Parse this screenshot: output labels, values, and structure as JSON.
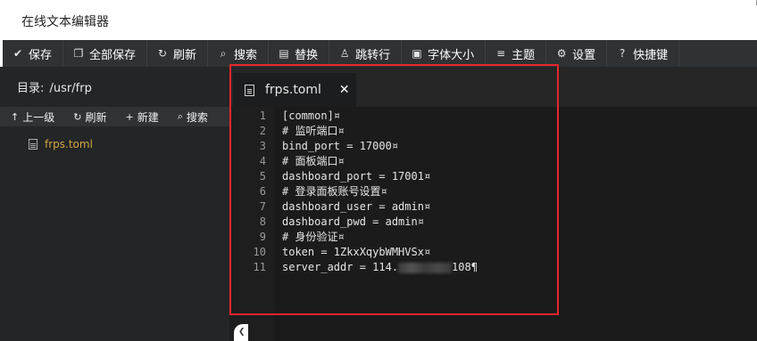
{
  "window": {
    "title": "在线文本编辑器"
  },
  "toolbar": [
    {
      "icon": "check-icon",
      "glyph": "✔",
      "label": "保存"
    },
    {
      "icon": "copy-icon",
      "glyph": "❐",
      "label": "全部保存"
    },
    {
      "icon": "refresh-icon",
      "glyph": "↻",
      "label": "刷新"
    },
    {
      "icon": "search-icon",
      "glyph": "⌕",
      "label": "搜索"
    },
    {
      "icon": "replace-icon",
      "glyph": "▤",
      "label": "替换"
    },
    {
      "icon": "goto-line-icon",
      "glyph": "♙",
      "label": "跳转行"
    },
    {
      "icon": "font-size-icon",
      "glyph": "▣",
      "label": "字体大小"
    },
    {
      "icon": "theme-icon",
      "glyph": "≡",
      "label": "主题"
    },
    {
      "icon": "settings-icon",
      "glyph": "⚙",
      "label": "设置"
    },
    {
      "icon": "help-icon",
      "glyph": "?",
      "label": "快捷键"
    }
  ],
  "sidebar": {
    "dir_label": "目录:",
    "dir_path": "/usr/frp",
    "actions": [
      {
        "icon": "arrow-up-icon",
        "glyph": "↑",
        "label": "上一级"
      },
      {
        "icon": "refresh-icon",
        "glyph": "↻",
        "label": "刷新"
      },
      {
        "icon": "plus-icon",
        "glyph": "+",
        "label": "新建"
      },
      {
        "icon": "search-icon",
        "glyph": "⌕",
        "label": "搜索"
      }
    ],
    "files": [
      {
        "name": "frps.toml"
      }
    ]
  },
  "editor": {
    "tab": {
      "name": "frps.toml",
      "close": "✕"
    },
    "lines": [
      "[common]¤",
      "# 监听端口¤",
      "bind_port = 17000¤",
      "# 面板端口¤",
      "dashboard_port = 17001¤",
      "# 登录面板账号设置¤",
      "dashboard_user = admin¤",
      "dashboard_pwd = admin¤",
      "# 身份验证¤",
      "token = 1ZkxXqybWMHVSx¤",
      "server_addr = 114."
    ],
    "line11_tail": "108¶",
    "line_numbers": [
      "1",
      "2",
      "3",
      "4",
      "5",
      "6",
      "7",
      "8",
      "9",
      "10",
      "11"
    ]
  },
  "colors": {
    "highlight_box": "#e8262c",
    "file_name": "#d4a645"
  }
}
